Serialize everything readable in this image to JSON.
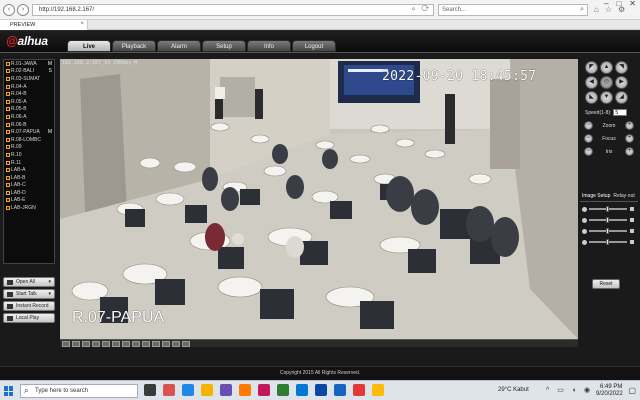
{
  "browser": {
    "address": "http://192.168.2.167/",
    "search_placeholder": "Search...",
    "tab_label": "PREVIEW",
    "nav_icons": [
      "back-icon",
      "forward-icon"
    ],
    "window_controls": [
      "minimize-icon",
      "maximize-icon",
      "close-icon"
    ]
  },
  "app": {
    "logo": "alhua",
    "tabs": [
      {
        "label": "Live",
        "active": true
      },
      {
        "label": "Playback",
        "active": false
      },
      {
        "label": "Alarm",
        "active": false
      },
      {
        "label": "Setup",
        "active": false
      },
      {
        "label": "Info",
        "active": false
      },
      {
        "label": "Logout",
        "active": false
      }
    ],
    "channels": [
      {
        "label": "R.01-JAWA",
        "flag": "M"
      },
      {
        "label": "R.02-BALI",
        "flag": "S"
      },
      {
        "label": "R.03-SUMAT",
        "flag": ""
      },
      {
        "label": "R.04-A",
        "flag": ""
      },
      {
        "label": "R.04-B",
        "flag": ""
      },
      {
        "label": "R.05-A",
        "flag": ""
      },
      {
        "label": "R.05-B",
        "flag": ""
      },
      {
        "label": "R.06-A",
        "flag": ""
      },
      {
        "label": "R.06-B",
        "flag": ""
      },
      {
        "label": "R.07-PAPUA",
        "flag": "M"
      },
      {
        "label": "R.08-LOMBC",
        "flag": ""
      },
      {
        "label": "R.09",
        "flag": ""
      },
      {
        "label": "R.10",
        "flag": ""
      },
      {
        "label": "R.11",
        "flag": ""
      },
      {
        "label": "LAB-A",
        "flag": ""
      },
      {
        "label": "LAB-B",
        "flag": ""
      },
      {
        "label": "LAB-C",
        "flag": ""
      },
      {
        "label": "LAB-D",
        "flag": ""
      },
      {
        "label": "LAB-E",
        "flag": ""
      },
      {
        "label": "LAB-JRGN",
        "flag": ""
      }
    ],
    "left_buttons": [
      {
        "label": "Open All",
        "caret": "▾"
      },
      {
        "label": "Start Talk",
        "caret": "▾"
      },
      {
        "label": "Instant Record",
        "caret": ""
      },
      {
        "label": "Local Play",
        "caret": ""
      }
    ],
    "video": {
      "info": "192.168.2.167_10_29Kbps_M",
      "timestamp": "2022-09-20 18:45:57",
      "channel_name": "R.07-PAPUA"
    },
    "ptz": {
      "speed_label": "Speed(1-8):",
      "speed_value": "5",
      "rows": [
        {
          "label": "Zoom"
        },
        {
          "label": "Focus"
        },
        {
          "label": "Iris"
        }
      ]
    },
    "image_setup": {
      "tabs": [
        "Image Setup",
        "Relay-out"
      ],
      "reset_label": "Reset"
    },
    "copyright": "Copyright 2015 All Rights Reserved."
  },
  "taskbar": {
    "search_text": "Type here to search",
    "weather": "29°C  Kabut",
    "time": "6:49 PM",
    "date": "9/20/2022"
  }
}
